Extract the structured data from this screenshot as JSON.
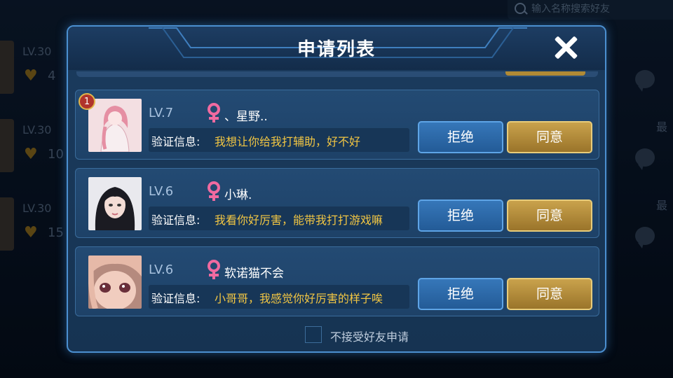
{
  "background": {
    "search_placeholder": "输入名称搜索好友",
    "rows": [
      {
        "level": "LV.30",
        "count": "4"
      },
      {
        "level": "LV.30",
        "count": "10"
      },
      {
        "level": "LV.30",
        "count": "15"
      }
    ],
    "side_labels": [
      "最",
      "最"
    ]
  },
  "dialog": {
    "title": "申请列表",
    "close_icon": "close-icon",
    "requests": [
      {
        "level": "LV.7",
        "gender_icon": "female-icon",
        "name": "、星野..",
        "rank_badge": "1",
        "msg_label": "验证信息:",
        "message": "我想让你给我打辅助，好不好",
        "reject": "拒绝",
        "accept": "同意"
      },
      {
        "level": "LV.6",
        "gender_icon": "female-icon",
        "name": "小琳.",
        "msg_label": "验证信息:",
        "message": "我看你好厉害，能带我打打游戏嘛",
        "reject": "拒绝",
        "accept": "同意"
      },
      {
        "level": "LV.6",
        "gender_icon": "female-icon",
        "name": "软诺猫不会",
        "msg_label": "验证信息:",
        "message": "小哥哥，我感觉你好厉害的样子唉",
        "reject": "拒绝",
        "accept": "同意"
      }
    ],
    "footer_checkbox_label": "不接受好友申请"
  },
  "colors": {
    "message_text": "#f2c643",
    "accept_button": "#b58d3d",
    "reject_button": "#2d6aa8",
    "female_symbol": "#f06aa0"
  }
}
